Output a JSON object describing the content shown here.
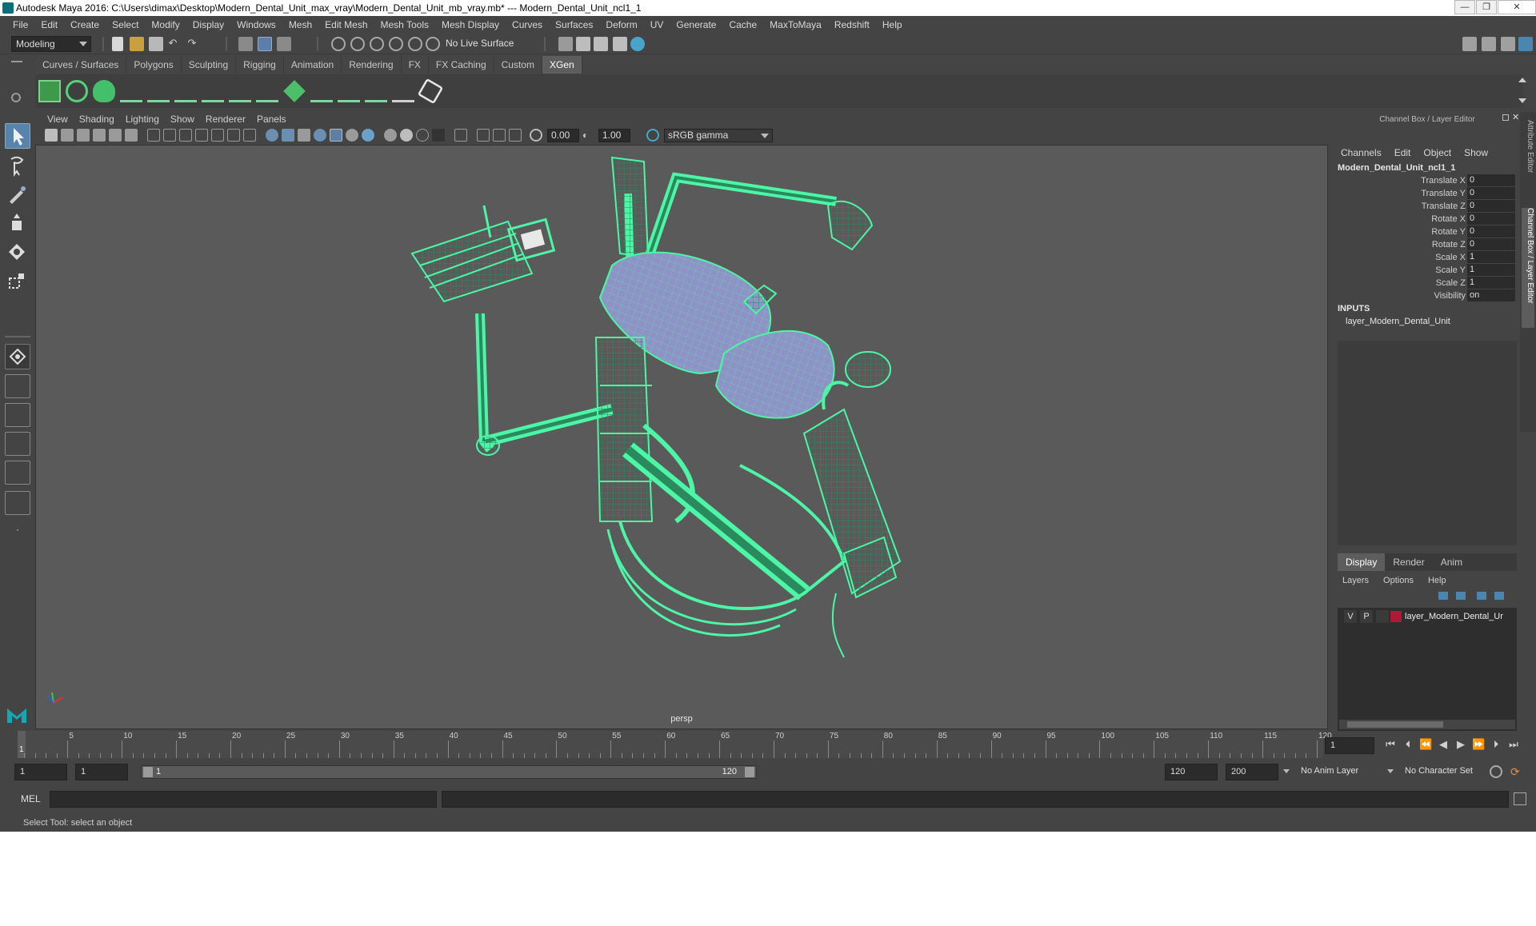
{
  "window": {
    "title": "Autodesk Maya 2016: C:\\Users\\dimax\\Desktop\\Modern_Dental_Unit_max_vray\\Modern_Dental_Unit_mb_vray.mb*   ---   Modern_Dental_Unit_ncl1_1",
    "minimize": "—",
    "maximize": "❐",
    "close": "✕"
  },
  "menubar": [
    "File",
    "Edit",
    "Create",
    "Select",
    "Modify",
    "Display",
    "Windows",
    "Mesh",
    "Edit Mesh",
    "Mesh Tools",
    "Mesh Display",
    "Curves",
    "Surfaces",
    "Deform",
    "UV",
    "Generate",
    "Cache",
    "MaxToMaya",
    "Redshift",
    "Help"
  ],
  "statusline": {
    "mode": "Modeling",
    "live_surface": "No Live Surface"
  },
  "shelf": {
    "tabs": [
      "Curves / Surfaces",
      "Polygons",
      "Sculpting",
      "Rigging",
      "Animation",
      "Rendering",
      "FX",
      "FX Caching",
      "Custom",
      "XGen"
    ],
    "active_tab": "XGen"
  },
  "viewport": {
    "menus": [
      "View",
      "Shading",
      "Lighting",
      "Show",
      "Renderer",
      "Panels"
    ],
    "exposure": "0.00",
    "gamma": "1.00",
    "color_space": "sRGB gamma",
    "camera": "persp"
  },
  "channel_box": {
    "header": "Channel Box / Layer Editor",
    "menus": [
      "Channels",
      "Edit",
      "Object",
      "Show"
    ],
    "object_name": "Modern_Dental_Unit_ncl1_1",
    "attributes": [
      {
        "label": "Translate X",
        "value": "0"
      },
      {
        "label": "Translate Y",
        "value": "0"
      },
      {
        "label": "Translate Z",
        "value": "0"
      },
      {
        "label": "Rotate X",
        "value": "0"
      },
      {
        "label": "Rotate Y",
        "value": "0"
      },
      {
        "label": "Rotate Z",
        "value": "0"
      },
      {
        "label": "Scale X",
        "value": "1"
      },
      {
        "label": "Scale Y",
        "value": "1"
      },
      {
        "label": "Scale Z",
        "value": "1"
      },
      {
        "label": "Visibility",
        "value": "on"
      }
    ],
    "inputs_label": "INPUTS",
    "input_node": "layer_Modern_Dental_Unit"
  },
  "side_tabs": [
    "Attribute Editor",
    "Channel Box / Layer Editor"
  ],
  "layer_editor": {
    "tabs": [
      "Display",
      "Render",
      "Anim"
    ],
    "active_tab": "Display",
    "menus": [
      "Layers",
      "Options",
      "Help"
    ],
    "layer": {
      "v": "V",
      "p": "P",
      "name": "layer_Modern_Dental_Ur",
      "color": "#b0183a"
    }
  },
  "timeline": {
    "ticks": [
      "5",
      "10",
      "15",
      "20",
      "25",
      "30",
      "35",
      "40",
      "45",
      "50",
      "55",
      "60",
      "65",
      "70",
      "75",
      "80",
      "85",
      "90",
      "95",
      "100",
      "105",
      "110",
      "115",
      "120"
    ],
    "current_marker": "1",
    "current_frame": "1"
  },
  "range": {
    "start": "1",
    "anim_start": "1",
    "slider_start": "1",
    "slider_end": "120",
    "end": "120",
    "anim_end": "200",
    "anim_layer": "No Anim Layer",
    "char_set": "No Character Set"
  },
  "command": {
    "mode": "MEL"
  },
  "help_line": "Select Tool: select an object",
  "colors": {
    "wire": "#4df5a6",
    "surface": "#8f92c6",
    "viewport_bg": "#5a5a5a"
  }
}
